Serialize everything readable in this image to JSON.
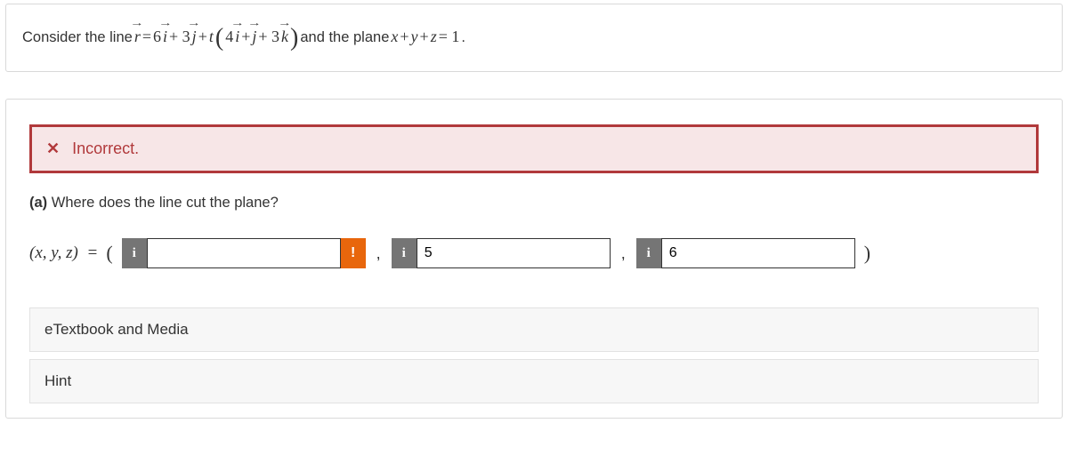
{
  "question": {
    "pre": "Consider the line ",
    "r": "r",
    "eq": " = ",
    "term1a": "6",
    "term1b": "i",
    "term2a": " + 3",
    "term2b": "j",
    "term3a": " + ",
    "term3t": "t",
    "lparen": "(",
    "term4a": "4",
    "term4b": "i",
    "term5a": " + ",
    "term5b": "j",
    "term6a": " + 3",
    "term6b": "k",
    "rparen": ")",
    "post1": " and the plane ",
    "plane_x": "x",
    "plane_plus1": " + ",
    "plane_y": "y",
    "plane_plus2": " + ",
    "plane_z": "z",
    "plane_eq": " = 1",
    "period": "."
  },
  "feedback": {
    "label": "Incorrect."
  },
  "part": {
    "tag": "(a)",
    "text": " Where does the line cut the plane?"
  },
  "answer": {
    "prefix": "(x, y, z)",
    "eq": "=",
    "open": "(",
    "close": ")",
    "info": "i",
    "warn": "!",
    "val1": "",
    "val2": "5",
    "val3": "6",
    "comma": ","
  },
  "links": {
    "etextbook": "eTextbook and Media",
    "hint": "Hint"
  }
}
